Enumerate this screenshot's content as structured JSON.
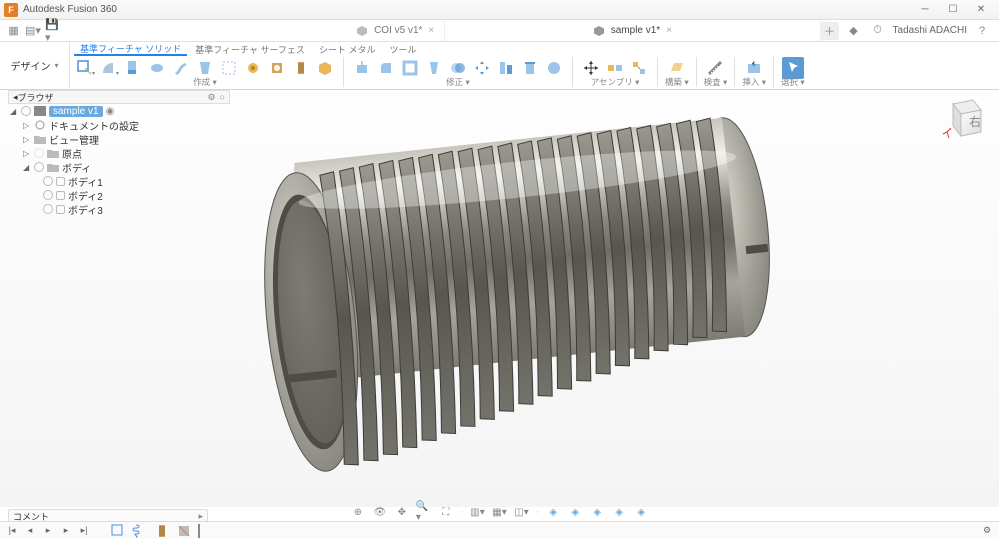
{
  "window": {
    "app_title": "Autodesk Fusion 360"
  },
  "tabs": {
    "inactive_icon": "cube",
    "inactive_label": "COI v5 v1*",
    "active_icon": "cube",
    "active_label": "sample v1*",
    "user_name": "Tadashi ADACHI"
  },
  "ribbon": {
    "workspace_label": "デザイン",
    "subtabs": {
      "solid": "基準フィーチャ ソリッド",
      "surface": "基準フィーチャ サーフェス",
      "sheet": "シート メタル",
      "tool": "ツール"
    },
    "group_labels": {
      "create": "作成",
      "modify": "修正",
      "assemble": "アセンブリ",
      "construct": "構築",
      "inspect": "検査",
      "insert": "挿入",
      "select": "選択"
    }
  },
  "browser": {
    "panel_title": "ブラウザ",
    "root": "sample v1",
    "doc_settings": "ドキュメントの設定",
    "views": "ビュー管理",
    "origin": "原点",
    "bodies": "ボディ",
    "body1": "ボディ1",
    "body2": "ボディ2",
    "body3": "ボディ3"
  },
  "viewcube": {
    "face": "右"
  },
  "comment": {
    "label": "コメント"
  },
  "navbar_icons": [
    "orbit",
    "look",
    "pan",
    "zoom",
    "fit",
    "grid",
    "split",
    "cam1",
    "cam2",
    "cam3",
    "cam4",
    "cam5"
  ]
}
